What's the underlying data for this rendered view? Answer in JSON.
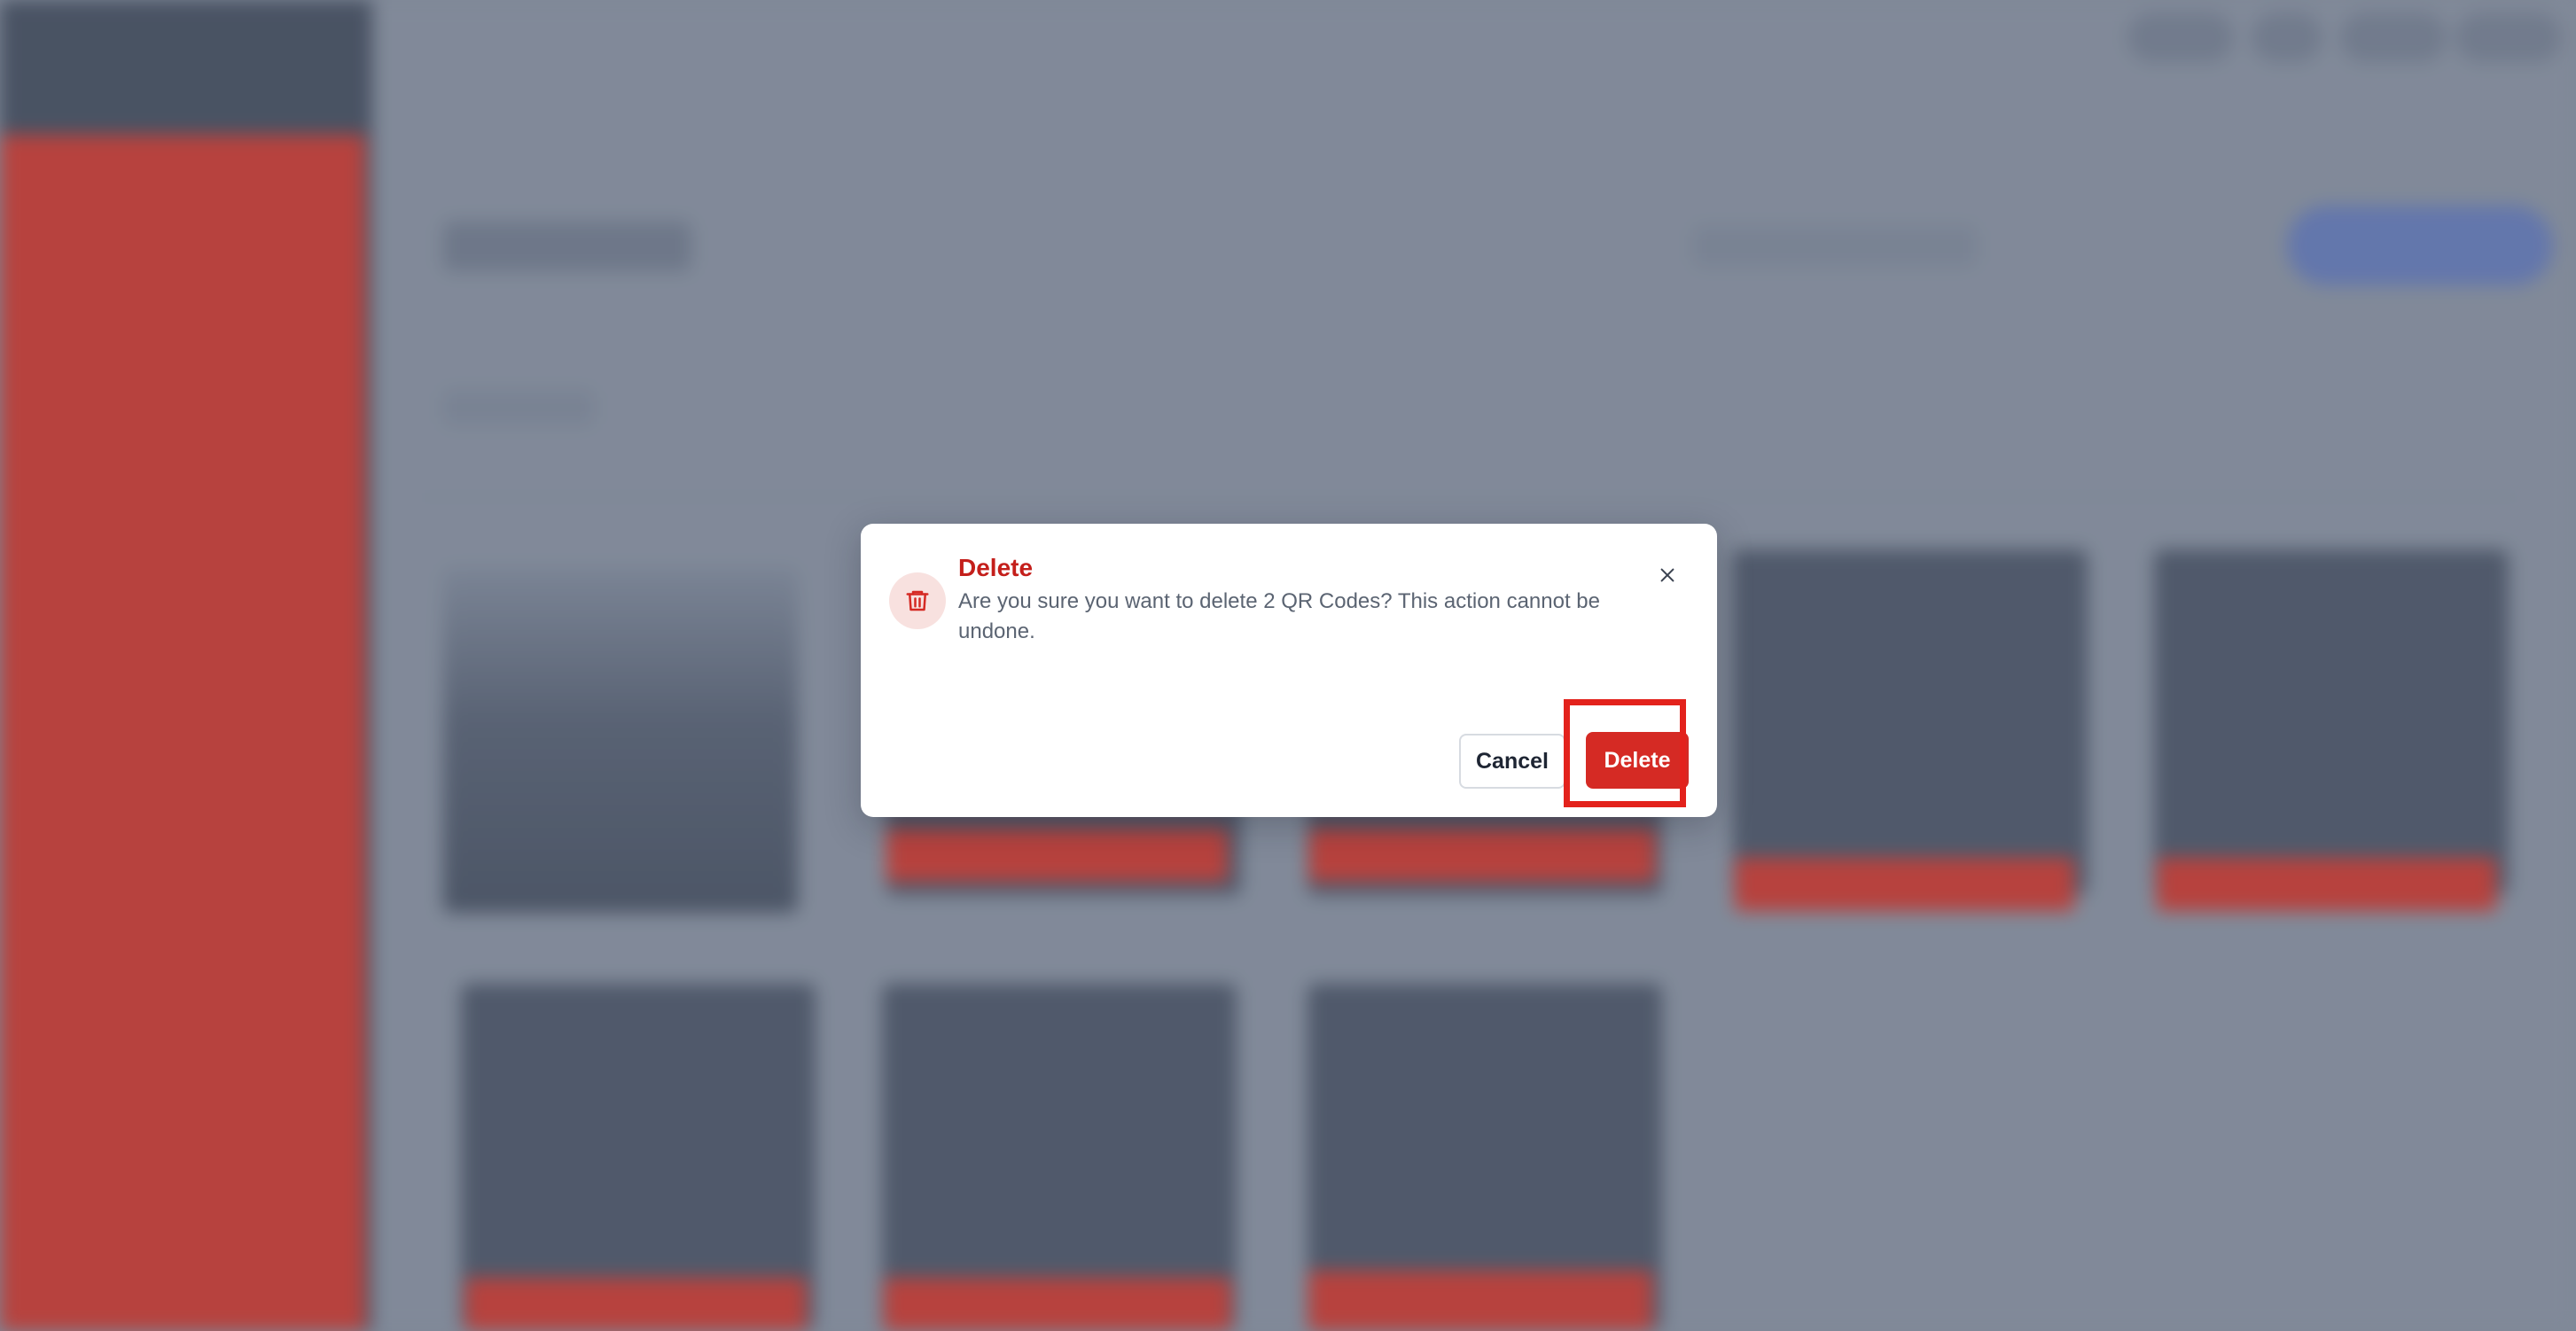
{
  "dialog": {
    "title": "Delete",
    "message": "Are you sure you want to delete 2 QR Codes? This action cannot be undone.",
    "cancel_label": "Cancel",
    "delete_label": "Delete",
    "icon": "trash-icon",
    "close_icon": "close-icon"
  },
  "colors": {
    "danger": "#d52a24",
    "title_red": "#c41f1b",
    "icon_bg": "#f8e1df",
    "redaction": "#cc2e23"
  }
}
